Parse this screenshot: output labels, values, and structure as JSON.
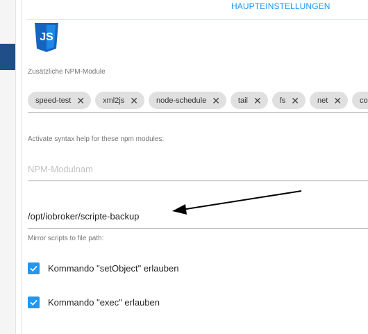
{
  "tab": {
    "label": "HAUPTEINSTELLUNGEN"
  },
  "logo": {
    "text": "JS"
  },
  "npm_modules": {
    "label": "Zusätzliche NPM-Module",
    "chips": [
      "speed-test",
      "xml2js",
      "node-schedule",
      "tail",
      "fs",
      "net",
      "countr"
    ]
  },
  "syntax_help": {
    "label": "Activate syntax help for these npm modules:",
    "placeholder": "NPM-Modulnam"
  },
  "mirror": {
    "value": "/opt/iobroker/scripte-backup",
    "label": "Mirror scripts to file path:"
  },
  "checkboxes": [
    {
      "label": "Kommando \"setObject\" erlauben",
      "checked": true
    },
    {
      "label": "Kommando \"exec\" erlauben",
      "checked": true
    }
  ],
  "colors": {
    "accent": "#2196f3",
    "sidebar_active": "#1f4f86",
    "chip_bg": "#e0e0e0"
  }
}
